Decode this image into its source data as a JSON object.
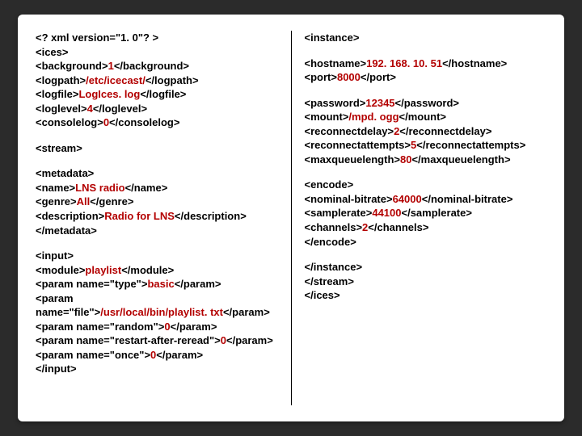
{
  "left": {
    "header": {
      "l1": "<? xml version=\"1. 0\"? >",
      "l2": "<ices>",
      "l3a": "<background>",
      "l3v": "1",
      "l3b": "</background>",
      "l4a": "<logpath>",
      "l4v": "/etc/icecast/",
      "l4b": "</logpath>",
      "l5a": "<logfile>",
      "l5v": "LogIces. log",
      "l5b": "</logfile>",
      "l6a": "<loglevel>",
      "l6v": "4",
      "l6b": "</loglevel>",
      "l7a": "<consolelog>",
      "l7v": "0",
      "l7b": "</consolelog>"
    },
    "stream": "<stream>",
    "metadata": {
      "open": "<metadata>",
      "nameA": "<name>",
      "nameV": "LNS radio",
      "nameB": "</name>",
      "genreA": "<genre>",
      "genreV": "All",
      "genreB": "</genre>",
      "descA": "<description>",
      "descV": "Radio for LNS",
      "descB": "</description>",
      "close": "</metadata>"
    },
    "input": {
      "open": "<input>",
      "modA": "<module>",
      "modV": "playlist",
      "modB": "</module>",
      "p1a": "<param name=\"type\">",
      "p1v": "basic",
      "p1b": "</param>",
      "p2a": "<param",
      "p2b": "name=\"file\">",
      "p2v": "/usr/local/bin/playlist. txt",
      "p2c": "</param>",
      "p3a": "<param name=\"random\">",
      "p3v": "0",
      "p3b": "</param>",
      "p4a": "<param name=\"restart-after-reread\">",
      "p4v": "0",
      "p4b": "</param>",
      "p5a": "<param name=\"once\">",
      "p5v": "0",
      "p5b": "</param>",
      "close": "</input>"
    }
  },
  "right": {
    "instance": "<instance>",
    "host": {
      "h1a": "<hostname>",
      "h1v": "192. 168. 10. 51",
      "h1b": "</hostname>",
      "h2a": "<port>",
      "h2v": "8000",
      "h2b": "</port>"
    },
    "auth": {
      "p1a": "<password>",
      "p1v": "12345",
      "p1b": "</password>",
      "m1a": "<mount>",
      "m1v": "/mpd. ogg",
      "m1b": "</mount>",
      "rdA": "<reconnectdelay>",
      "rdV": "2",
      "rdB": "</reconnectdelay>",
      "raA": "<reconnectattempts>",
      "raV": "5",
      "raB": "</reconnectattempts>",
      "mqA": "<maxqueuelength>",
      "mqV": "80",
      "mqB": "</maxqueuelength>"
    },
    "encode": {
      "open": "<encode>",
      "nbA": "<nominal-bitrate>",
      "nbV": "64000",
      "nbB": "</nominal-bitrate>",
      "srA": "<samplerate>",
      "srV": "44100",
      "srB": "</samplerate>",
      "chA": "<channels>",
      "chV": "2",
      "chB": "</channels>",
      "close": "</encode>"
    },
    "closing": {
      "c1": "</instance>",
      "c2": "</stream>",
      "c3": "</ices>"
    }
  }
}
